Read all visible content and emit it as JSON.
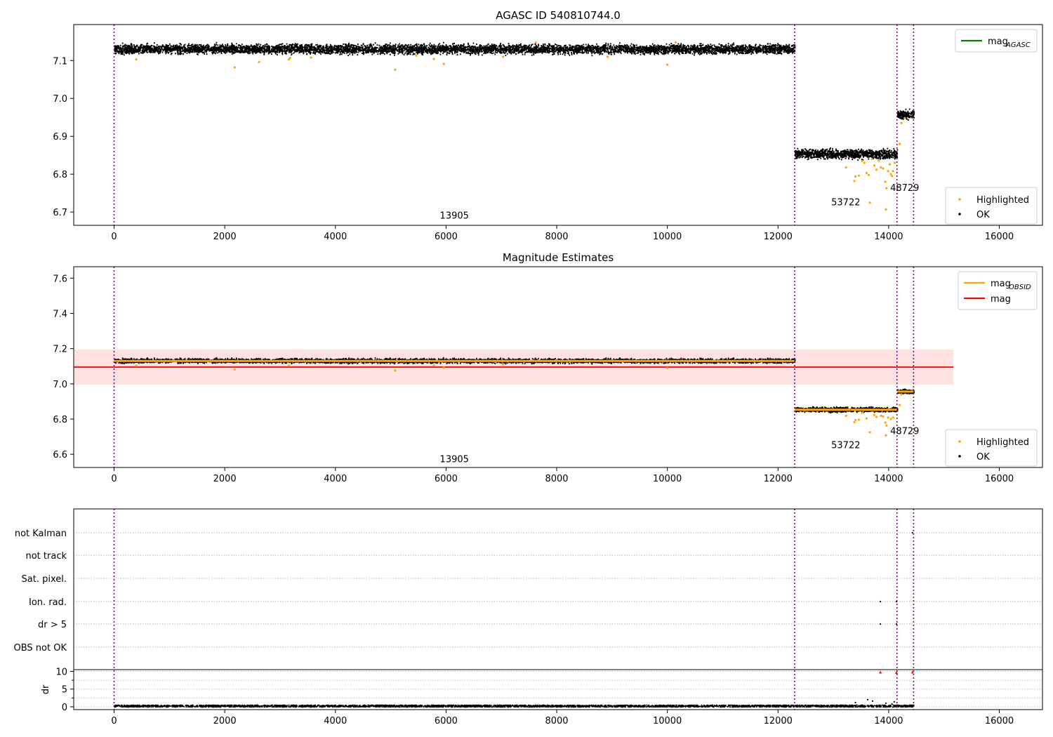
{
  "chart_data": [
    {
      "type": "scatter",
      "title": "AGASC ID 540810744.0",
      "xlim": [
        -730,
        16780
      ],
      "ylim": [
        6.665,
        7.195
      ],
      "xticks": [
        0,
        2000,
        4000,
        6000,
        8000,
        10000,
        12000,
        14000,
        16000
      ],
      "yticks": [
        6.7,
        6.8,
        6.9,
        7.0,
        7.1
      ],
      "vlines": [
        0,
        12300,
        14150,
        14450
      ],
      "segments": [
        {
          "x": [
            0,
            12300
          ],
          "mag": 7.13,
          "spread": 0.012
        },
        {
          "x": [
            12300,
            14150
          ],
          "mag": 6.853,
          "spread": 0.012
        },
        {
          "x": [
            14150,
            14450
          ],
          "mag": 6.956,
          "spread": 0.012
        }
      ],
      "highlighted_points": [
        [
          400,
          7.103
        ],
        [
          2180,
          7.082
        ],
        [
          2620,
          7.096
        ],
        [
          3160,
          7.103
        ],
        [
          3180,
          7.107
        ],
        [
          3560,
          7.108
        ],
        [
          5080,
          7.076
        ],
        [
          5460,
          7.113
        ],
        [
          5780,
          7.104
        ],
        [
          5960,
          7.091
        ],
        [
          7030,
          7.11
        ],
        [
          7620,
          7.148
        ],
        [
          8920,
          7.11
        ],
        [
          10000,
          7.089
        ],
        [
          10150,
          7.148
        ],
        [
          13230,
          6.818
        ],
        [
          13380,
          6.782
        ],
        [
          13400,
          6.794
        ],
        [
          13460,
          6.796
        ],
        [
          13520,
          6.835
        ],
        [
          13560,
          6.83
        ],
        [
          13600,
          6.803
        ],
        [
          13640,
          6.798
        ],
        [
          13660,
          6.725
        ],
        [
          13700,
          6.84
        ],
        [
          13740,
          6.823
        ],
        [
          13780,
          6.812
        ],
        [
          13820,
          6.836
        ],
        [
          13860,
          6.818
        ],
        [
          13900,
          6.815
        ],
        [
          13940,
          6.78
        ],
        [
          13950,
          6.707
        ],
        [
          13960,
          6.763
        ],
        [
          13990,
          6.808
        ],
        [
          14020,
          6.826
        ],
        [
          14040,
          6.8
        ],
        [
          14060,
          6.795
        ],
        [
          14080,
          6.808
        ],
        [
          14110,
          6.83
        ],
        [
          14230,
          6.935
        ],
        [
          14290,
          6.948
        ],
        [
          14200,
          6.88
        ]
      ],
      "annotations": [
        {
          "text": "13905",
          "x": 6150,
          "y": 6.683
        },
        {
          "text": "53722",
          "x": 13225,
          "y": 6.718
        },
        {
          "text": "48729",
          "x": 14290,
          "y": 6.756
        }
      ],
      "legend_upper": [
        {
          "label": "mag",
          "sub": "AGASC",
          "color": "#008000"
        }
      ],
      "legend_lower": [
        {
          "label": "Highlighted",
          "color": "#ffa500"
        },
        {
          "label": "OK",
          "color": "#000000"
        }
      ]
    },
    {
      "type": "scatter",
      "title": "Magnitude Estimates",
      "xlim": [
        -730,
        16780
      ],
      "ylim": [
        6.525,
        7.665
      ],
      "xticks": [
        0,
        2000,
        4000,
        6000,
        8000,
        10000,
        12000,
        14000,
        16000
      ],
      "yticks": [
        6.6,
        6.8,
        7.0,
        7.2,
        7.4,
        7.6
      ],
      "vlines": [
        0,
        12300,
        14150,
        14450
      ],
      "segments": [
        {
          "x": [
            0,
            12300
          ],
          "mag": 7.13,
          "spread": 0.012
        },
        {
          "x": [
            12300,
            14150
          ],
          "mag": 6.853,
          "spread": 0.012
        },
        {
          "x": [
            14150,
            14450
          ],
          "mag": 6.956,
          "spread": 0.012
        }
      ],
      "mag_line": {
        "value": 7.095,
        "x": [
          -730,
          15170
        ],
        "band": [
          6.995,
          7.195
        ]
      },
      "highlighted_points": [
        [
          400,
          7.103
        ],
        [
          2180,
          7.082
        ],
        [
          3160,
          7.103
        ],
        [
          5080,
          7.076
        ],
        [
          5780,
          7.104
        ],
        [
          5960,
          7.091
        ],
        [
          7030,
          7.11
        ],
        [
          10000,
          7.089
        ],
        [
          13230,
          6.818
        ],
        [
          13380,
          6.782
        ],
        [
          13400,
          6.794
        ],
        [
          13460,
          6.796
        ],
        [
          13520,
          6.835
        ],
        [
          13600,
          6.803
        ],
        [
          13660,
          6.725
        ],
        [
          13740,
          6.823
        ],
        [
          13780,
          6.812
        ],
        [
          13860,
          6.818
        ],
        [
          13900,
          6.815
        ],
        [
          13940,
          6.78
        ],
        [
          13950,
          6.707
        ],
        [
          13960,
          6.763
        ],
        [
          13990,
          6.808
        ],
        [
          14040,
          6.8
        ],
        [
          14080,
          6.808
        ],
        [
          14230,
          6.94
        ],
        [
          14200,
          6.88
        ]
      ],
      "annotations": [
        {
          "text": "13905",
          "x": 6150,
          "y": 6.555
        },
        {
          "text": "53722",
          "x": 13225,
          "y": 6.634
        },
        {
          "text": "48729",
          "x": 14290,
          "y": 6.714
        }
      ],
      "legend_upper": [
        {
          "label": "mag",
          "sub": "OBSID",
          "color": "#ffa500"
        },
        {
          "label": "mag",
          "sub": "",
          "color": "#ff0000"
        }
      ],
      "legend_lower": [
        {
          "label": "Highlighted",
          "color": "#ffa500"
        },
        {
          "label": "OK",
          "color": "#000000"
        }
      ]
    },
    {
      "type": "scatter",
      "title": "",
      "xlim": [
        -730,
        16780
      ],
      "xticks": [
        0,
        2000,
        4000,
        6000,
        8000,
        10000,
        12000,
        14000,
        16000
      ],
      "vlines": [
        0,
        12300,
        14150,
        14450
      ],
      "flag_labels": [
        "not Kalman",
        "not track",
        "Sat. pixel.",
        "Ion. rad.",
        "dr > 5",
        "OBS not OK"
      ],
      "flag_points": [
        {
          "flag": "Ion. rad.",
          "x": [
            13850,
            14140
          ]
        },
        {
          "flag": "dr > 5",
          "x": [
            13850,
            14140
          ]
        },
        {
          "flag": "not Kalman",
          "x": [
            14430
          ]
        }
      ],
      "dr_ylabel": "dr",
      "dr_ylim": [
        -0.8,
        10.5
      ],
      "dr_yticks": [
        0,
        5,
        10
      ],
      "dr_minor_yticks": [
        2.5,
        7.5
      ],
      "dr_segment": {
        "x": [
          0,
          14450
        ],
        "value": 0.2
      },
      "dr_outliers_black": [
        [
          13400,
          1.2
        ],
        [
          13620,
          2.0
        ],
        [
          13710,
          1.6
        ],
        [
          13950,
          1.0
        ],
        [
          14060,
          0.8
        ],
        [
          14100,
          1.4
        ]
      ],
      "dr_outliers_red": [
        [
          13850,
          9.8
        ],
        [
          14140,
          9.7
        ],
        [
          14430,
          9.8
        ]
      ]
    }
  ]
}
